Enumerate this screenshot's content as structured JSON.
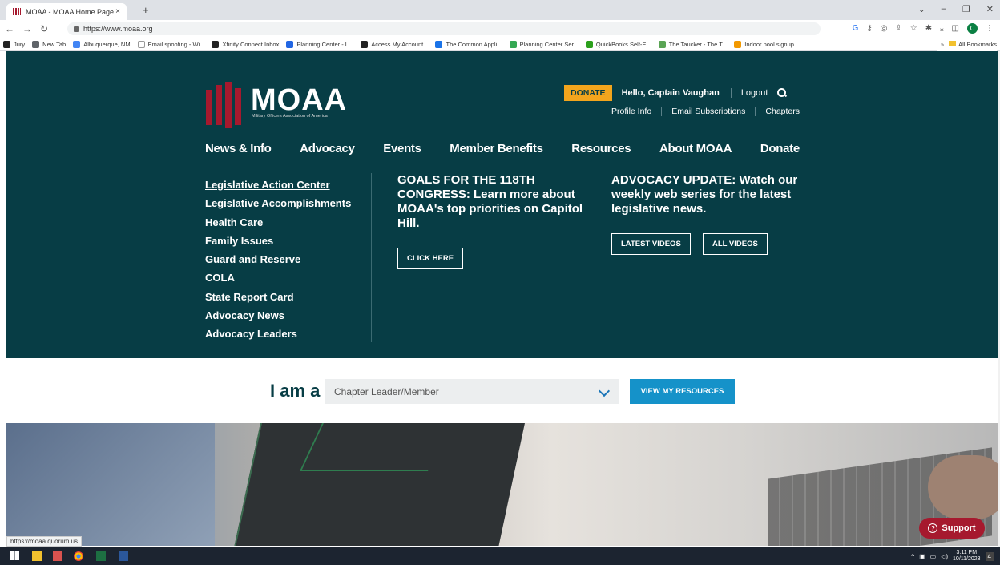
{
  "browser": {
    "tab_title": "MOAA - MOAA Home Page",
    "tab_close": "×",
    "new_tab": "+",
    "url": "https://www.moaa.org",
    "bookmarks": [
      {
        "label": "Jury",
        "color": "#222222"
      },
      {
        "label": "New Tab",
        "color": "#5f6368"
      },
      {
        "label": "Albuquerque, NM",
        "color": "#4285f4"
      },
      {
        "label": "Email spoofing - Wi...",
        "color": "#ffffff"
      },
      {
        "label": "Xfinity Connect Inbox",
        "color": "#222222"
      },
      {
        "label": "Planning Center - L...",
        "color": "#2266e3"
      },
      {
        "label": "Access My Account...",
        "color": "#222222"
      },
      {
        "label": "The Common Appli...",
        "color": "#1a73e8"
      },
      {
        "label": "Planning Center Ser...",
        "color": "#34a853"
      },
      {
        "label": "QuickBooks Self-E...",
        "color": "#2ca01c"
      },
      {
        "label": "The Taucker - The T...",
        "color": "#5aa454"
      },
      {
        "label": "Indoor pool signup",
        "color": "#f29900"
      }
    ],
    "bookmarks_more": "»",
    "all_bookmarks": "All Bookmarks",
    "avatar_letter": "C",
    "status_url": "https://moaa.quorum.us"
  },
  "site": {
    "logo_word": "MOAA",
    "logo_sub": "Military Officers Association of America",
    "donate_label": "DONATE",
    "greeting": "Hello, Captain Vaughan",
    "logout": "Logout",
    "sublinks": [
      "Profile Info",
      "Email Subscriptions",
      "Chapters"
    ],
    "nav": [
      "News & Info",
      "Advocacy",
      "Events",
      "Member Benefits",
      "Resources",
      "About MOAA",
      "Donate"
    ],
    "submenu": [
      "Legislative Action Center",
      "Legislative Accomplishments",
      "Health Care",
      "Family Issues",
      "Guard and Reserve",
      "COLA",
      "State Report Card",
      "Advocacy News",
      "Advocacy Leaders"
    ],
    "promo1": {
      "text": "GOALS FOR THE 118TH CONGRESS: Learn more about MOAA's top priorities on Capitol Hill.",
      "button": "CLICK HERE"
    },
    "promo2": {
      "text": "ADVOCACY UPDATE: Watch our weekly web series for the latest legislative news.",
      "button1": "LATEST VIDEOS",
      "button2": "ALL VIDEOS"
    },
    "iam_label": "I am a",
    "iam_value": "Chapter Leader/Member",
    "view_button": "VIEW MY RESOURCES",
    "support": "Support"
  },
  "taskbar": {
    "time": "3:11 PM",
    "date": "10/11/2023",
    "notifications": "4"
  },
  "colors": {
    "brand_teal": "#073d45",
    "brand_red": "#a6192e",
    "donate_orange": "#f3a51d",
    "cta_blue": "#1592c9"
  }
}
